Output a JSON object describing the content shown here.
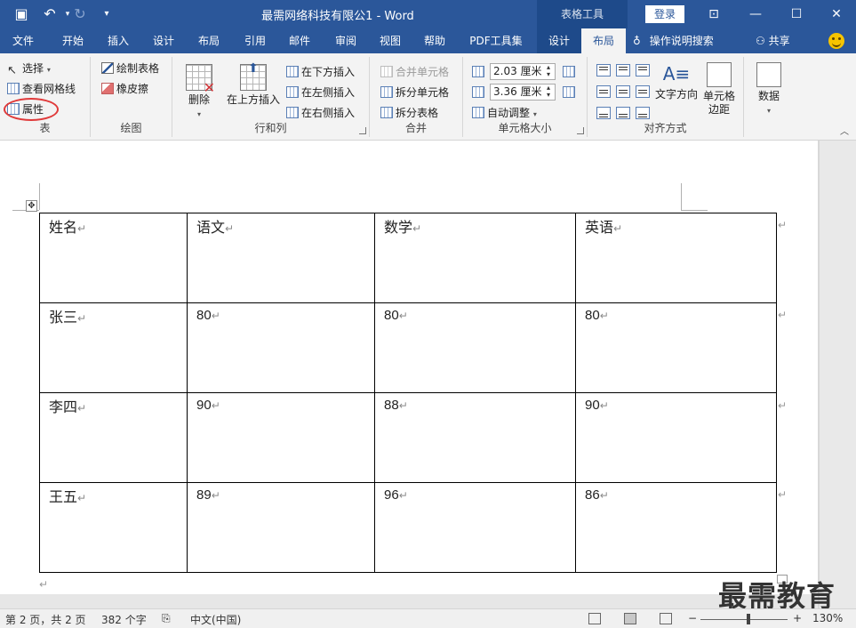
{
  "titlebar": {
    "title": "最需网络科技有限公1  -  Word",
    "context_tools": "表格工具",
    "login": "登录",
    "save_icon": "save-icon",
    "undo_icon": "undo-icon",
    "redo_icon": "redo-icon"
  },
  "tabs": [
    "文件",
    "开始",
    "插入",
    "设计",
    "布局",
    "引用",
    "邮件",
    "审阅",
    "视图",
    "帮助",
    "PDF工具集",
    "设计",
    "布局"
  ],
  "tell_me": "操作说明搜索",
  "share": "共享",
  "ribbon": {
    "table": {
      "label": "表",
      "select": "选择",
      "gridlines": "查看网格线",
      "properties": "属性"
    },
    "draw": {
      "label": "绘图",
      "draw_table": "绘制表格",
      "eraser": "橡皮擦"
    },
    "rows_cols": {
      "label": "行和列",
      "delete": "删除",
      "insert_above": "在上方插入",
      "insert_below": "在下方插入",
      "insert_left": "在左侧插入",
      "insert_right": "在右侧插入"
    },
    "merge": {
      "label": "合并",
      "merge_cells": "合并单元格",
      "split_cells": "拆分单元格",
      "split_table": "拆分表格"
    },
    "cell_size": {
      "label": "单元格大小",
      "height": "2.03 厘米",
      "width": "3.36 厘米",
      "autofit": "自动调整"
    },
    "alignment": {
      "label": "对齐方式",
      "text_direction": "文字方向",
      "cell_margins_1": "单元格",
      "cell_margins_2": "边距"
    },
    "data": {
      "label": "数据"
    }
  },
  "document": {
    "table": [
      [
        "姓名",
        "语文",
        "数学",
        "英语"
      ],
      [
        "张三",
        "80",
        "80",
        "80"
      ],
      [
        "李四",
        "90",
        "88",
        "90"
      ],
      [
        "王五",
        "89",
        "96",
        "86"
      ]
    ],
    "paragraph_mark": "↵"
  },
  "watermark": "最需教育",
  "status": {
    "page": "第 2 页，共 2 页",
    "words": "382 个字",
    "language": "中文(中国)",
    "zoom": "130%",
    "minus": "−",
    "plus": "+"
  }
}
